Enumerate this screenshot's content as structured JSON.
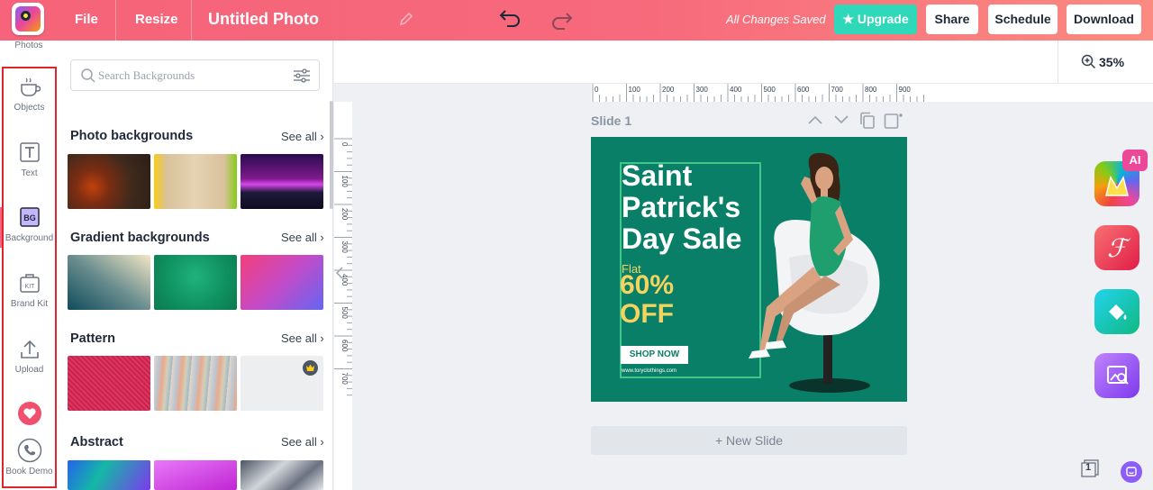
{
  "header": {
    "menu_file": "File",
    "menu_resize": "Resize",
    "title": "Untitled Photo",
    "save_status": "All Changes Saved",
    "btn_upgrade": "Upgrade",
    "btn_share": "Share",
    "btn_schedule": "Schedule",
    "btn_download": "Download"
  },
  "rail": {
    "photos": "Photos",
    "objects": "Objects",
    "text": "Text",
    "background": "Background",
    "brand_kit": "Brand Kit",
    "upload": "Upload",
    "book_demo": "Book Demo"
  },
  "panel": {
    "search_placeholder": "Search Backgrounds",
    "sections": [
      {
        "title": "Photo backgrounds",
        "see_all": "See all"
      },
      {
        "title": "Gradient backgrounds",
        "see_all": "See all"
      },
      {
        "title": "Pattern",
        "see_all": "See all"
      },
      {
        "title": "Abstract",
        "see_all": "See all"
      }
    ]
  },
  "canvas": {
    "zoom": "35%",
    "slide_label": "Slide 1",
    "new_slide": "+ New Slide",
    "page_count": "1",
    "ruler_h": [
      "0",
      "100",
      "200",
      "300",
      "400",
      "500",
      "600",
      "700",
      "800",
      "900"
    ],
    "ruler_v": [
      "0",
      "100",
      "200",
      "300",
      "400",
      "500",
      "600",
      "700"
    ]
  },
  "design": {
    "line1": "Saint",
    "line2": "Patrick's",
    "line3": "Day Sale",
    "flat": "Flat",
    "percent": "60%",
    "off": "OFF",
    "shop_now": "SHOP NOW",
    "website": "www.toryclothings.com"
  },
  "right_apps": {
    "ai_badge": "AI"
  },
  "colors": {
    "header_start": "#f6637a",
    "header_end": "#fb8a80",
    "upgrade": "#2fd8b9",
    "design_bg": "#0a7f68",
    "design_yellow": "#f4d35e",
    "rail_highlight": "#e0242f"
  }
}
